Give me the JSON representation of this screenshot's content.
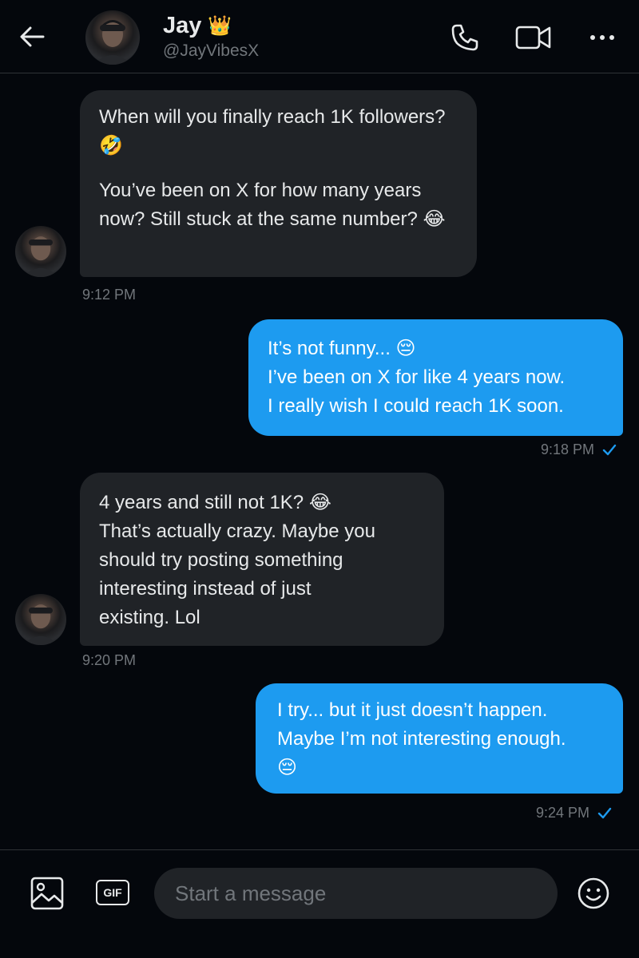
{
  "header": {
    "name": "Jay",
    "badge_emoji": "👑",
    "handle": "@JayVibesX"
  },
  "messages": [
    {
      "direction": "received",
      "paragraphs": [
        "When will you finally reach 1K followers? 🤣",
        "You’ve been on X for how many years now? Still stuck at the same number? 😂"
      ],
      "time": "9:12 PM"
    },
    {
      "direction": "sent",
      "lines": [
        "It’s not funny... 😔",
        "I’ve been on X for like 4 years now.",
        "I really wish I could reach 1K soon."
      ],
      "time": "9:18 PM",
      "status": "✓"
    },
    {
      "direction": "received",
      "lines": [
        "4 years and still not 1K? 😂",
        "That’s actually crazy. Maybe you",
        "should try posting something",
        "interesting instead of just",
        "existing. Lol"
      ],
      "time": "9:20 PM"
    },
    {
      "direction": "sent",
      "lines": [
        "I try... but it just doesn’t happen.",
        "Maybe I’m not interesting enough.",
        "😔"
      ],
      "time": "9:24 PM",
      "status": "✓"
    }
  ],
  "composer": {
    "placeholder": "Start a message",
    "gif_label": "GIF"
  },
  "icons": {
    "back": "arrow-left-icon",
    "call": "phone-icon",
    "video": "video-camera-icon",
    "more": "more-horizontal-icon",
    "media": "image-icon",
    "gif": "gif-icon",
    "emoji": "emoji-smile-icon",
    "read_receipt": "checkmark-icon"
  },
  "colors": {
    "background": "#04070c",
    "received_bubble": "#202327",
    "sent_bubble": "#1d9bf0",
    "accent": "#1d9bf0",
    "muted_text": "#71767b"
  }
}
